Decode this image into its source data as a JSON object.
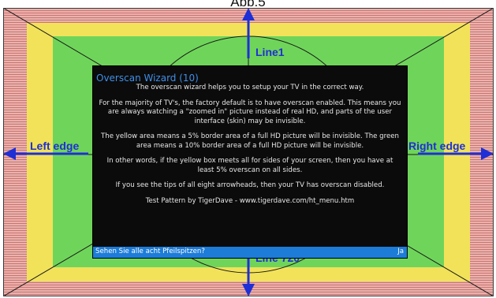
{
  "caption": "Abb.5",
  "labels": {
    "top": "Line1",
    "bottom": "Line 720",
    "left": "Left edge",
    "right": "Right edge"
  },
  "dialog": {
    "title": "Overscan Wizard (10)",
    "paragraphs": [
      "The overscan wizard helps you to setup your TV in the correct way.",
      "For the majority of TV's, the factory default is to have overscan enabled. This means you are always watching a \"zoomed in\" picture instead of real HD, and parts of the user interface (skin) may be invisible.",
      "The yellow area means a 5% border area of a full HD picture will be invisible. The green area means a 10% border area of a full HD picture will be invisible.",
      "In other words, if the yellow box meets all for sides of your screen, then you have at least 5% overscan on all sides.",
      "If you see the tips of all eight arrowheads, then your TV has overscan disabled.",
      "Test Pattern by TigerDave - www.tigerdave.com/ht_menu.htm"
    ],
    "question": "Sehen Sie alle acht Pfeilspitzen?",
    "answer": "Ja"
  },
  "colors": {
    "red_zone": "#e7b3ae",
    "yellow_zone": "#f2e25a",
    "green_zone": "#6fd55a",
    "arrow": "#1f2fd6",
    "dialog_bg": "#0b0b0b",
    "dialog_title": "#3f8fe8",
    "selection_bar": "#1d7cd8"
  }
}
